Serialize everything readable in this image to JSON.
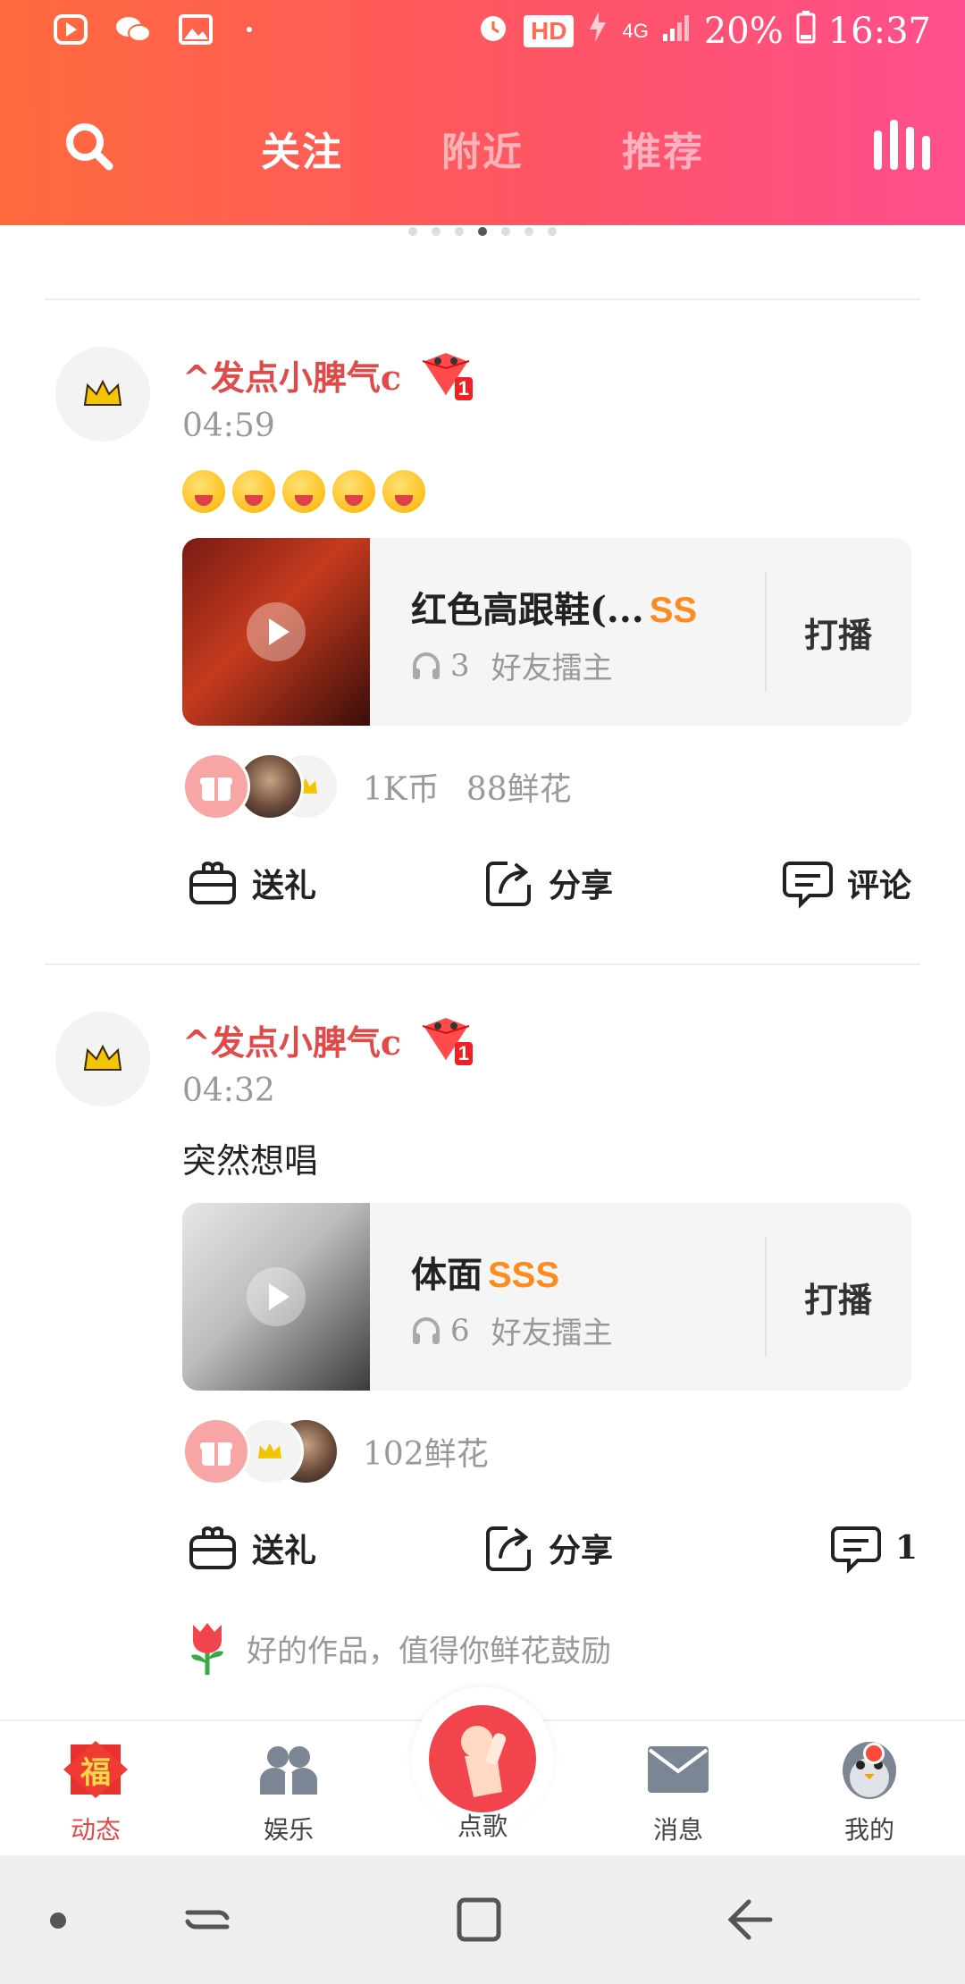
{
  "status_bar": {
    "hd": "HD",
    "network": "4G",
    "battery": "20%",
    "time": "16:37"
  },
  "header": {
    "tabs": [
      {
        "label": "关注",
        "active": true
      },
      {
        "label": "附近",
        "active": false
      },
      {
        "label": "推荐",
        "active": false
      }
    ],
    "page_dots_total": 7,
    "page_dots_active": 4
  },
  "posts": [
    {
      "username": "^发点小脾气c",
      "level_badge": "1",
      "time": "04:59",
      "text": "",
      "emoji_count": 5,
      "song": {
        "title": "红色高跟鞋(...",
        "rank": "SS",
        "listens": "3",
        "host_label": "好友擂主",
        "action": "打播"
      },
      "gift_stats": [
        "1K币",
        "88鲜花"
      ],
      "actions": {
        "gift": "送礼",
        "share": "分享",
        "comment": "评论"
      }
    },
    {
      "username": "^发点小脾气c",
      "level_badge": "1",
      "time": "04:32",
      "text": "突然想唱",
      "song": {
        "title": "体面",
        "rank": "SSS",
        "listens": "6",
        "host_label": "好友擂主",
        "action": "打播"
      },
      "gift_stats": [
        "102鲜花"
      ],
      "actions": {
        "gift": "送礼",
        "share": "分享",
        "comment": "1"
      },
      "hint": "好的作品，值得你鲜花鼓励"
    }
  ],
  "tabbar": {
    "items": [
      "动态",
      "娱乐",
      "点歌",
      "消息",
      "我的"
    ],
    "fu_char": "福",
    "active": "动态"
  },
  "colors": {
    "header_start": "#ff6a3c",
    "header_end": "#ff4f8e",
    "username": "#e24a4a",
    "rank": "#ff8a1e",
    "tab_active": "#e24a4a"
  }
}
